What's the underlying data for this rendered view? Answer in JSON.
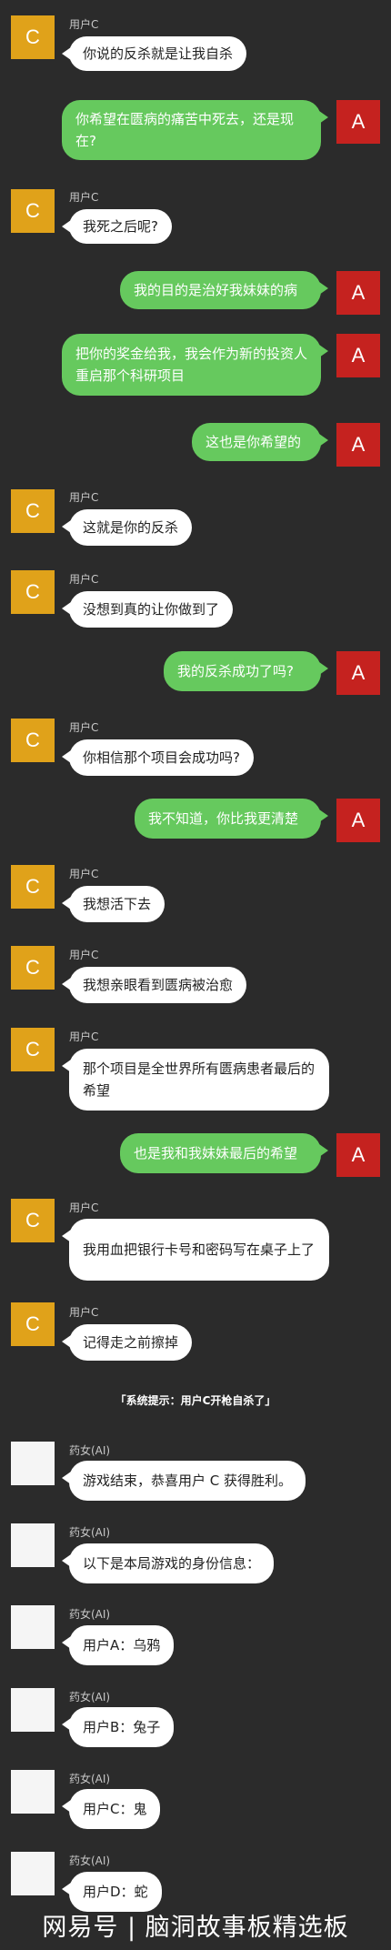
{
  "users": {
    "c_avatar": "C",
    "c_name": "用户C",
    "a_avatar": "A",
    "ai_name": "药女(AI)"
  },
  "messages": [
    {
      "side": "left",
      "text": "你说的反杀就是让我自杀"
    },
    {
      "side": "right",
      "text": "你希望在匮病的痛苦中死去，还是现在?"
    },
    {
      "side": "left",
      "text": "我死之后呢?"
    },
    {
      "side": "right",
      "text": "我的目的是治好我妹妹的病"
    },
    {
      "side": "right",
      "text": "把你的奖金给我，我会作为新的投资人重启那个科研项目"
    },
    {
      "side": "right",
      "text": "这也是你希望的"
    },
    {
      "side": "left",
      "text": "这就是你的反杀"
    },
    {
      "side": "left",
      "text": "没想到真的让你做到了"
    },
    {
      "side": "right",
      "text": "我的反杀成功了吗?"
    },
    {
      "side": "left",
      "text": "你相信那个项目会成功吗?"
    },
    {
      "side": "right",
      "text": "我不知道，你比我更清楚"
    },
    {
      "side": "left",
      "text": "我想活下去"
    },
    {
      "side": "left",
      "text": "我想亲眼看到匮病被治愈"
    },
    {
      "side": "left",
      "text": "那个项目是全世界所有匮病患者最后的希望"
    },
    {
      "side": "right",
      "text": "也是我和我妹妹最后的希望"
    },
    {
      "side": "left",
      "text": "我用血把银行卡号和密码写在桌子上了"
    },
    {
      "side": "left",
      "text": "记得走之前擦掉"
    }
  ],
  "system_notice": "「系统提示：用户C开枪自杀了」",
  "ai_messages": [
    {
      "text": "游戏结束，恭喜用户 C 获得胜利。"
    },
    {
      "text": "以下是本局游戏的身份信息："
    },
    {
      "text": "用户A：乌鸦"
    },
    {
      "text": "用户B：兔子"
    },
    {
      "text": "用户C：鬼"
    },
    {
      "text": "用户D：蛇"
    }
  ],
  "watermark": "网易号 | 脑洞故事板精选板"
}
